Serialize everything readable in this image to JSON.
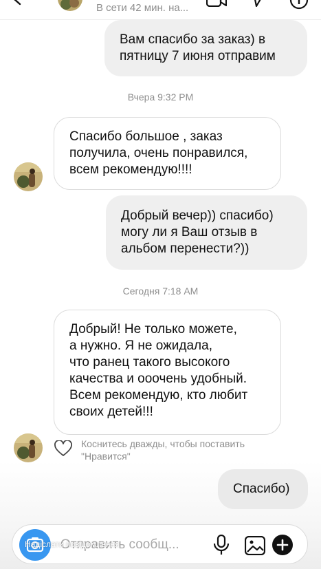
{
  "header": {
    "status": "В сети 42 мин. на..."
  },
  "messages": {
    "m1": "Вам спасибо за заказ) в\nпятницу 7 июня отправим",
    "ts1": "Вчера 9:32 PM",
    "m2": "Спасибо большое , заказ\nполучила, очень понравился,\nвсем рекомендую!!!!",
    "m3": "Добрый вечер)) спасибо)\nмогу ли я Ваш отзыв в\nальбом перенести?))",
    "ts2": "Сегодня 7:18 AM",
    "m4": "Добрый!  Не только можете,\nа нужно.  Я не ожидала,\nчто ранец такого высокого\nкачества и ооочень удобный.\nВсем рекомендую, кто любит\nсвоих детей!!!",
    "m5": "Спасибо)"
  },
  "like_hint": "Коснитесь дважды, чтобы поставить\n\"Нравится\"",
  "composer": {
    "placeholder": "Отправить сообщ...",
    "overlay": "Надіслати повідомлення"
  },
  "colors": {
    "outgoing_bubble": "#efefef",
    "incoming_border": "#dbdbdb",
    "camera_button": "#3897f0",
    "muted_text": "#8e8e8e"
  },
  "icons": [
    "back-icon",
    "video-camera-icon",
    "direct-send-icon",
    "info-icon",
    "heart-icon",
    "camera-icon",
    "microphone-icon",
    "gallery-icon",
    "plus-icon"
  ]
}
